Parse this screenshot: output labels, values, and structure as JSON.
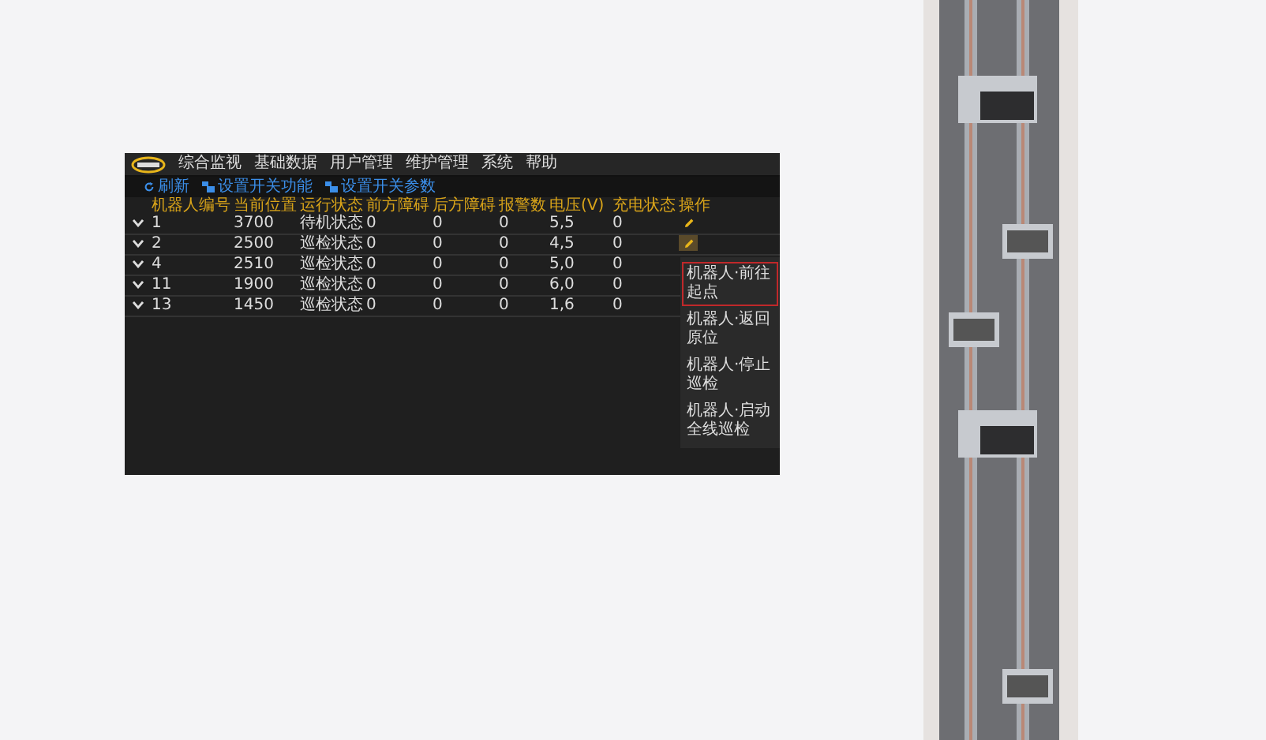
{
  "app": {
    "nav": [
      "综合监视",
      "基础数据",
      "用户管理",
      "维护管理",
      "系统",
      "帮助"
    ],
    "toolbar": [
      {
        "kind": "refresh",
        "label": "刷新"
      },
      {
        "kind": "robot",
        "label": "设置开关功能"
      },
      {
        "kind": "robot",
        "label": "设置开关参数"
      }
    ],
    "table": {
      "columns": [
        "机器人编号",
        "当前位置",
        "运行状态",
        "前方障碍",
        "后方障碍",
        "报警数",
        "电压(V)",
        "充电状态",
        "操作"
      ],
      "rows": [
        {
          "cells": [
            "1",
            "3700",
            "待机状态",
            "0",
            "0",
            "0",
            "5,5",
            "0"
          ],
          "edit_button": {
            "active": false
          }
        },
        {
          "cells": [
            "2",
            "2500",
            "巡检状态",
            "0",
            "0",
            "0",
            "4,5",
            "0"
          ],
          "edit_button": {
            "active": true
          }
        },
        {
          "cells": [
            "4",
            "2510",
            "巡检状态",
            "0",
            "0",
            "0",
            "5,0",
            "0"
          ]
        },
        {
          "cells": [
            "11",
            "1900",
            "巡检状态",
            "0",
            "0",
            "0",
            "6,0",
            "0"
          ]
        },
        {
          "cells": [
            "13",
            "1450",
            "巡检状态",
            "0",
            "0",
            "0",
            "1,6",
            "0"
          ]
        }
      ]
    },
    "menu": [
      {
        "label": "机器人·前往起点",
        "selected": true
      },
      {
        "label": "机器人·返回原位",
        "selected": false
      },
      {
        "label": "机器人·停止巡检",
        "selected": false
      },
      {
        "label": "机器人·启动全线巡检",
        "selected": false
      }
    ]
  }
}
